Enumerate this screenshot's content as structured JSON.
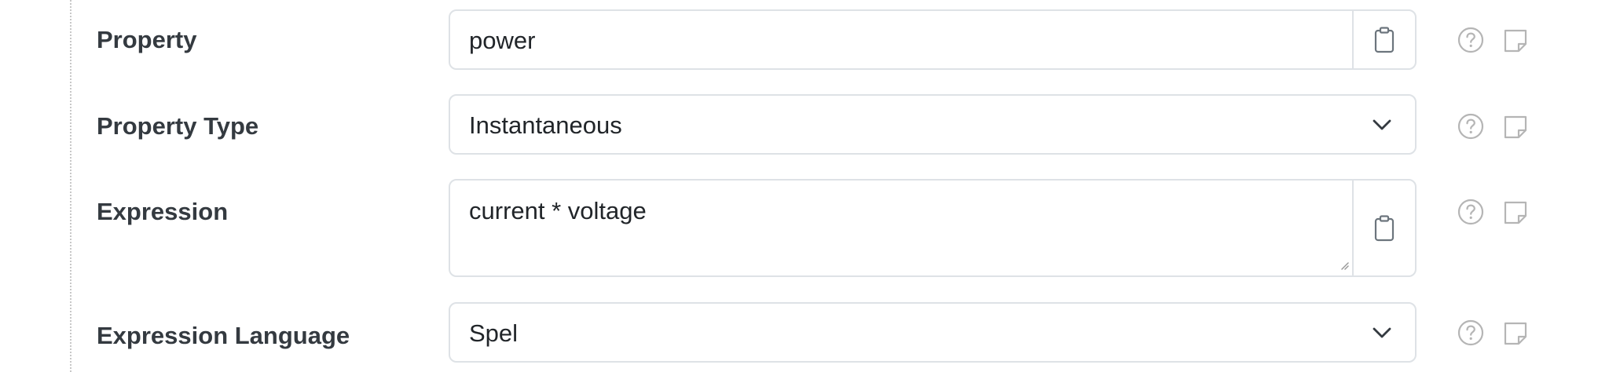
{
  "form": {
    "rows": [
      {
        "label": "Property",
        "value": "power",
        "control": "text-input",
        "addon_icon": "clipboard-icon"
      },
      {
        "label": "Property Type",
        "value": "Instantaneous",
        "control": "select",
        "addon_icon": "chevron-down-icon"
      },
      {
        "label": "Expression",
        "value": "current * voltage",
        "control": "textarea",
        "addon_icon": "clipboard-icon"
      },
      {
        "label": "Expression Language",
        "value": "Spel",
        "control": "select",
        "addon_icon": "chevron-down-icon"
      }
    ],
    "row_icons": [
      "help-circle-icon",
      "sticky-note-icon"
    ]
  },
  "colors": {
    "border": "#dee2e6",
    "label_text": "#343a40",
    "value_text": "#212529",
    "icon_gray": "#b5b5b5",
    "dotted_rule": "#c8c8c8"
  }
}
